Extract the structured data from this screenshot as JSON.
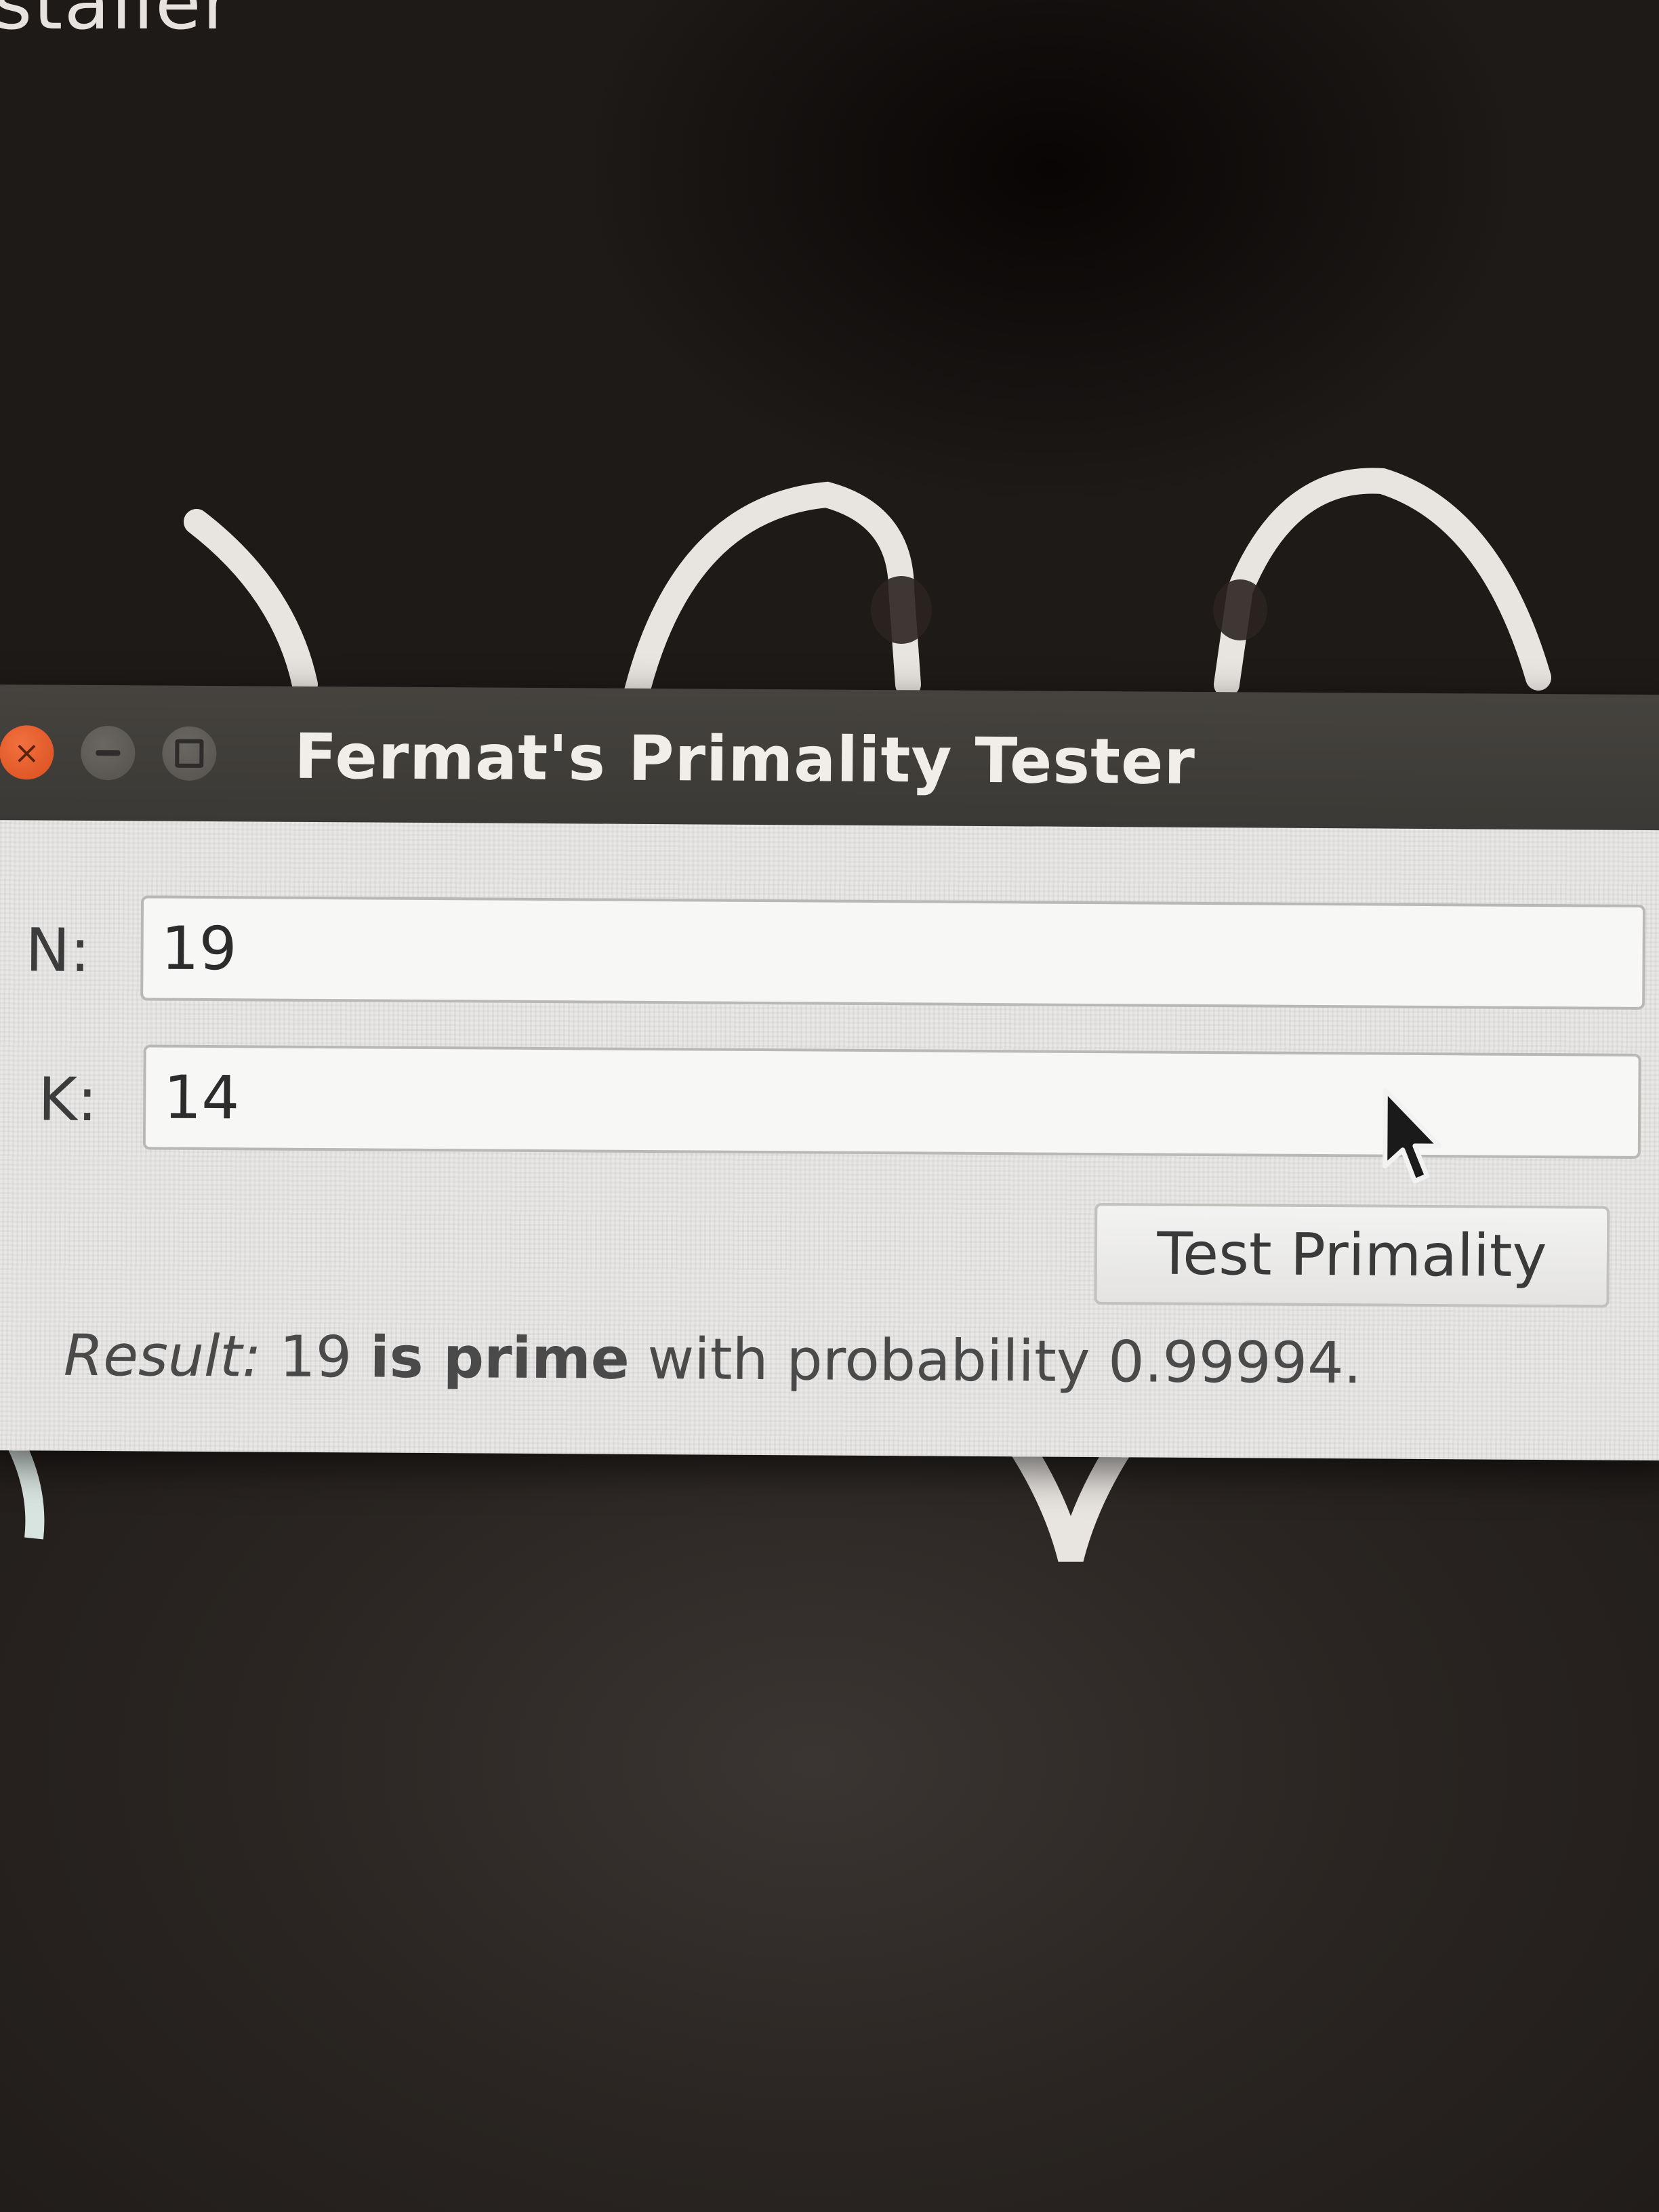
{
  "desktop": {
    "top_text": "staller"
  },
  "window": {
    "title": "Fermat's Primality Tester",
    "controls": {
      "close_glyph": "×"
    }
  },
  "form": {
    "n_label": "N:",
    "n_value": "19",
    "k_label": "K:",
    "k_value": "14",
    "test_button_label": "Test Primality"
  },
  "result": {
    "label": "Result:",
    "number": "19",
    "verdict": "is prime",
    "suffix": "with probability 0.99994."
  },
  "colors": {
    "close_button": "#e45a28",
    "titlebar": "#3f3d39",
    "content_bg": "#e9e8e6"
  }
}
